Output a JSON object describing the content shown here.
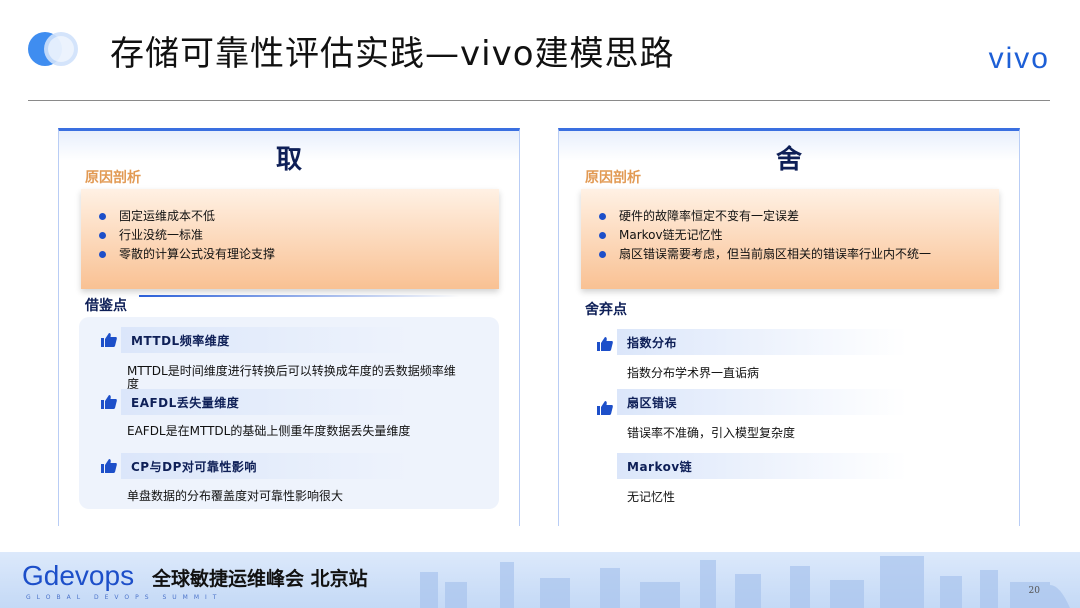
{
  "header": {
    "title": "存储可靠性评估实践—vivo建模思路",
    "brand": "vivo"
  },
  "left": {
    "heading": "取",
    "reason_label": "原因剖析",
    "reasons": [
      "固定运维成本不低",
      "行业没统一标准",
      "零散的计算公式没有理论支撑"
    ],
    "section_label": "借鉴点",
    "items": [
      {
        "title": "MTTDL频率维度",
        "desc": "MTTDL是时间维度进行转换后可以转换成年度的丢数据频率维度"
      },
      {
        "title": "EAFDL丢失量维度",
        "desc": "EAFDL是在MTTDL的基础上侧重年度数据丢失量维度"
      },
      {
        "title": "CP与DP对可靠性影响",
        "desc": "单盘数据的分布覆盖度对可靠性影响很大"
      }
    ]
  },
  "right": {
    "heading": "舍",
    "reason_label": "原因剖析",
    "reasons": [
      "硬件的故障率恒定不变有一定误差",
      "Markov链无记忆性",
      "扇区错误需要考虑，但当前扇区相关的错误率行业内不统一"
    ],
    "section_label": "舍弃点",
    "items": [
      {
        "title": "指数分布",
        "desc": "指数分布学术界一直诟病"
      },
      {
        "title": "扇区错误",
        "desc": "错误率不准确，引入模型复杂度"
      },
      {
        "title": "Markov链",
        "desc": "无记忆性"
      }
    ]
  },
  "footer": {
    "brand": "Gdevops",
    "subtitle": "全球敏捷运维峰会 北京站",
    "tagline": "GLOBAL DEVOPS SUMMIT",
    "page_number": "20"
  },
  "colors": {
    "accent": "#3a6fe0",
    "navy": "#0e1f57",
    "orange": "#e29a54",
    "brand_blue": "#1d5fd6"
  },
  "icons": [
    "logo-circles-icon",
    "thumbs-up-icon"
  ]
}
